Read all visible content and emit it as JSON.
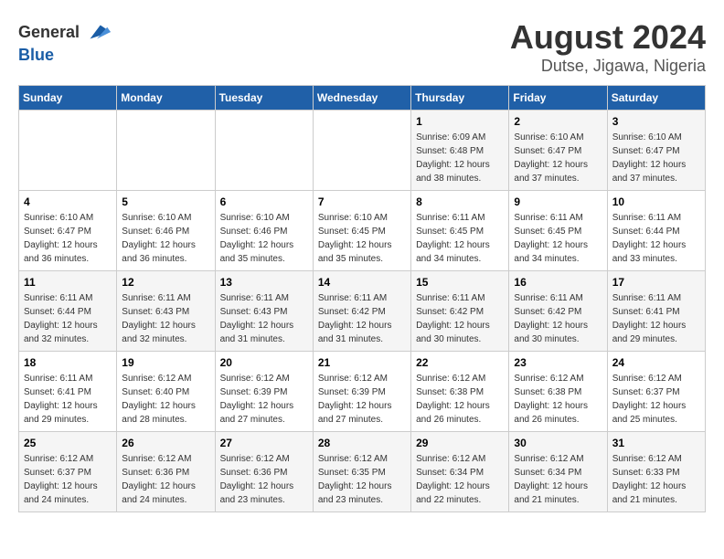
{
  "header": {
    "logo_general": "General",
    "logo_blue": "Blue",
    "title": "August 2024",
    "subtitle": "Dutse, Jigawa, Nigeria"
  },
  "calendar": {
    "days_of_week": [
      "Sunday",
      "Monday",
      "Tuesday",
      "Wednesday",
      "Thursday",
      "Friday",
      "Saturday"
    ],
    "weeks": [
      [
        {
          "day": "",
          "sunrise": "",
          "sunset": "",
          "daylight": ""
        },
        {
          "day": "",
          "sunrise": "",
          "sunset": "",
          "daylight": ""
        },
        {
          "day": "",
          "sunrise": "",
          "sunset": "",
          "daylight": ""
        },
        {
          "day": "",
          "sunrise": "",
          "sunset": "",
          "daylight": ""
        },
        {
          "day": "1",
          "sunrise": "Sunrise: 6:09 AM",
          "sunset": "Sunset: 6:48 PM",
          "daylight": "Daylight: 12 hours and 38 minutes."
        },
        {
          "day": "2",
          "sunrise": "Sunrise: 6:10 AM",
          "sunset": "Sunset: 6:47 PM",
          "daylight": "Daylight: 12 hours and 37 minutes."
        },
        {
          "day": "3",
          "sunrise": "Sunrise: 6:10 AM",
          "sunset": "Sunset: 6:47 PM",
          "daylight": "Daylight: 12 hours and 37 minutes."
        }
      ],
      [
        {
          "day": "4",
          "sunrise": "Sunrise: 6:10 AM",
          "sunset": "Sunset: 6:47 PM",
          "daylight": "Daylight: 12 hours and 36 minutes."
        },
        {
          "day": "5",
          "sunrise": "Sunrise: 6:10 AM",
          "sunset": "Sunset: 6:46 PM",
          "daylight": "Daylight: 12 hours and 36 minutes."
        },
        {
          "day": "6",
          "sunrise": "Sunrise: 6:10 AM",
          "sunset": "Sunset: 6:46 PM",
          "daylight": "Daylight: 12 hours and 35 minutes."
        },
        {
          "day": "7",
          "sunrise": "Sunrise: 6:10 AM",
          "sunset": "Sunset: 6:45 PM",
          "daylight": "Daylight: 12 hours and 35 minutes."
        },
        {
          "day": "8",
          "sunrise": "Sunrise: 6:11 AM",
          "sunset": "Sunset: 6:45 PM",
          "daylight": "Daylight: 12 hours and 34 minutes."
        },
        {
          "day": "9",
          "sunrise": "Sunrise: 6:11 AM",
          "sunset": "Sunset: 6:45 PM",
          "daylight": "Daylight: 12 hours and 34 minutes."
        },
        {
          "day": "10",
          "sunrise": "Sunrise: 6:11 AM",
          "sunset": "Sunset: 6:44 PM",
          "daylight": "Daylight: 12 hours and 33 minutes."
        }
      ],
      [
        {
          "day": "11",
          "sunrise": "Sunrise: 6:11 AM",
          "sunset": "Sunset: 6:44 PM",
          "daylight": "Daylight: 12 hours and 32 minutes."
        },
        {
          "day": "12",
          "sunrise": "Sunrise: 6:11 AM",
          "sunset": "Sunset: 6:43 PM",
          "daylight": "Daylight: 12 hours and 32 minutes."
        },
        {
          "day": "13",
          "sunrise": "Sunrise: 6:11 AM",
          "sunset": "Sunset: 6:43 PM",
          "daylight": "Daylight: 12 hours and 31 minutes."
        },
        {
          "day": "14",
          "sunrise": "Sunrise: 6:11 AM",
          "sunset": "Sunset: 6:42 PM",
          "daylight": "Daylight: 12 hours and 31 minutes."
        },
        {
          "day": "15",
          "sunrise": "Sunrise: 6:11 AM",
          "sunset": "Sunset: 6:42 PM",
          "daylight": "Daylight: 12 hours and 30 minutes."
        },
        {
          "day": "16",
          "sunrise": "Sunrise: 6:11 AM",
          "sunset": "Sunset: 6:42 PM",
          "daylight": "Daylight: 12 hours and 30 minutes."
        },
        {
          "day": "17",
          "sunrise": "Sunrise: 6:11 AM",
          "sunset": "Sunset: 6:41 PM",
          "daylight": "Daylight: 12 hours and 29 minutes."
        }
      ],
      [
        {
          "day": "18",
          "sunrise": "Sunrise: 6:11 AM",
          "sunset": "Sunset: 6:41 PM",
          "daylight": "Daylight: 12 hours and 29 minutes."
        },
        {
          "day": "19",
          "sunrise": "Sunrise: 6:12 AM",
          "sunset": "Sunset: 6:40 PM",
          "daylight": "Daylight: 12 hours and 28 minutes."
        },
        {
          "day": "20",
          "sunrise": "Sunrise: 6:12 AM",
          "sunset": "Sunset: 6:39 PM",
          "daylight": "Daylight: 12 hours and 27 minutes."
        },
        {
          "day": "21",
          "sunrise": "Sunrise: 6:12 AM",
          "sunset": "Sunset: 6:39 PM",
          "daylight": "Daylight: 12 hours and 27 minutes."
        },
        {
          "day": "22",
          "sunrise": "Sunrise: 6:12 AM",
          "sunset": "Sunset: 6:38 PM",
          "daylight": "Daylight: 12 hours and 26 minutes."
        },
        {
          "day": "23",
          "sunrise": "Sunrise: 6:12 AM",
          "sunset": "Sunset: 6:38 PM",
          "daylight": "Daylight: 12 hours and 26 minutes."
        },
        {
          "day": "24",
          "sunrise": "Sunrise: 6:12 AM",
          "sunset": "Sunset: 6:37 PM",
          "daylight": "Daylight: 12 hours and 25 minutes."
        }
      ],
      [
        {
          "day": "25",
          "sunrise": "Sunrise: 6:12 AM",
          "sunset": "Sunset: 6:37 PM",
          "daylight": "Daylight: 12 hours and 24 minutes."
        },
        {
          "day": "26",
          "sunrise": "Sunrise: 6:12 AM",
          "sunset": "Sunset: 6:36 PM",
          "daylight": "Daylight: 12 hours and 24 minutes."
        },
        {
          "day": "27",
          "sunrise": "Sunrise: 6:12 AM",
          "sunset": "Sunset: 6:36 PM",
          "daylight": "Daylight: 12 hours and 23 minutes."
        },
        {
          "day": "28",
          "sunrise": "Sunrise: 6:12 AM",
          "sunset": "Sunset: 6:35 PM",
          "daylight": "Daylight: 12 hours and 23 minutes."
        },
        {
          "day": "29",
          "sunrise": "Sunrise: 6:12 AM",
          "sunset": "Sunset: 6:34 PM",
          "daylight": "Daylight: 12 hours and 22 minutes."
        },
        {
          "day": "30",
          "sunrise": "Sunrise: 6:12 AM",
          "sunset": "Sunset: 6:34 PM",
          "daylight": "Daylight: 12 hours and 21 minutes."
        },
        {
          "day": "31",
          "sunrise": "Sunrise: 6:12 AM",
          "sunset": "Sunset: 6:33 PM",
          "daylight": "Daylight: 12 hours and 21 minutes."
        }
      ]
    ]
  }
}
